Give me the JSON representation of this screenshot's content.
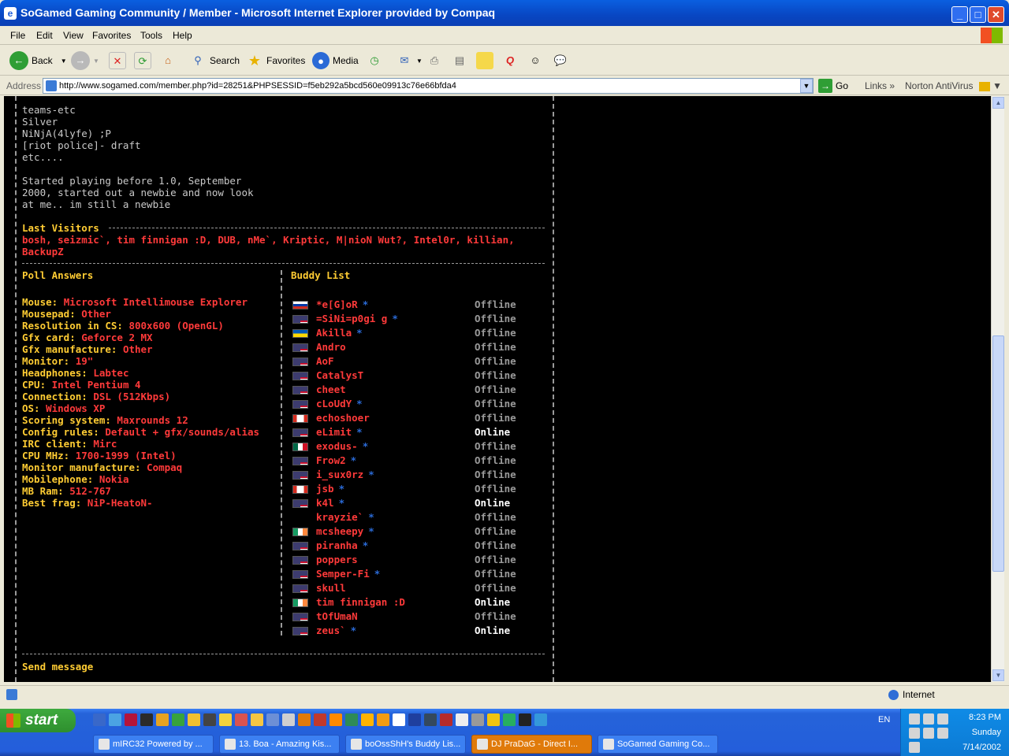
{
  "window": {
    "title": "SoGamed Gaming Community / Member - Microsoft Internet Explorer provided by Compaq"
  },
  "menu": [
    "File",
    "Edit",
    "View",
    "Favorites",
    "Tools",
    "Help"
  ],
  "toolbar": {
    "back": "Back",
    "search": "Search",
    "favorites": "Favorites",
    "media": "Media"
  },
  "address": {
    "label": "Address",
    "url": "http://www.sogamed.com/member.php?id=28251&PHPSESSID=f5eb292a5bcd560e09913c76e66bfda4",
    "go": "Go",
    "links": "Links",
    "norton": "Norton AntiVirus"
  },
  "profile": {
    "about_lines": [
      "teams-etc",
      "Silver",
      "NiNjA(4lyfe) ;P",
      "[riot police]- draft",
      "etc....",
      "",
      "Started playing before 1.0, September",
      "2000, started out a newbie and now look",
      "at me.. im still a newbie"
    ],
    "last_visitors_title": "Last Visitors",
    "last_visitors": "bosh, seizmic`, tim finnigan :D, DUB, nMe`, Kriptic, M|nioN Wut?, Intel0r, killian, BackupZ",
    "poll_title": "Poll Answers",
    "poll": [
      {
        "label": "Mouse:",
        "value": "Microsoft Intellimouse Explorer"
      },
      {
        "label": "Mousepad:",
        "value": "Other"
      },
      {
        "label": "Resolution in CS:",
        "value": "800x600 (OpenGL)"
      },
      {
        "label": "Gfx card:",
        "value": "Geforce 2 MX"
      },
      {
        "label": "Gfx manufacture:",
        "value": "Other"
      },
      {
        "label": "Monitor:",
        "value": "19\""
      },
      {
        "label": "Headphones:",
        "value": "Labtec"
      },
      {
        "label": "CPU:",
        "value": "Intel Pentium 4"
      },
      {
        "label": "Connection:",
        "value": "DSL (512Kbps)"
      },
      {
        "label": "OS:",
        "value": "Windows XP"
      },
      {
        "label": "Scoring system:",
        "value": "Maxrounds 12"
      },
      {
        "label": "Config rules:",
        "value": "Default + gfx/sounds/alias"
      },
      {
        "label": "IRC client:",
        "value": "Mirc"
      },
      {
        "label": "CPU MHz:",
        "value": "1700-1999 (Intel)"
      },
      {
        "label": "Monitor manufacture:",
        "value": "Compaq"
      },
      {
        "label": "Mobilephone:",
        "value": "Nokia"
      },
      {
        "label": "MB Ram:",
        "value": "512-767"
      },
      {
        "label": "Best frag:",
        "value": "NiP-HeatoN-"
      }
    ],
    "buddy_title": "Buddy List",
    "buddies": [
      {
        "name": "*e[G]oR",
        "star": "*",
        "status": "Offline",
        "flag": "ru"
      },
      {
        "name": "=SiNi=p0gi g",
        "star": "*",
        "status": "Offline",
        "flag": "us"
      },
      {
        "name": "Akilla",
        "star": "*",
        "status": "Offline",
        "flag": "ua"
      },
      {
        "name": "Andro",
        "star": "",
        "status": "Offline",
        "flag": "us"
      },
      {
        "name": "AoF",
        "star": "",
        "status": "Offline",
        "flag": "us"
      },
      {
        "name": "CatalysT",
        "star": "",
        "status": "Offline",
        "flag": "us"
      },
      {
        "name": "cheet",
        "star": "",
        "status": "Offline",
        "flag": "us"
      },
      {
        "name": "cLoUdY",
        "star": "*",
        "status": "Offline",
        "flag": "us"
      },
      {
        "name": "echoshoer",
        "star": "",
        "status": "Offline",
        "flag": "ca"
      },
      {
        "name": "eLimit",
        "star": "*",
        "status": "Online",
        "flag": "us"
      },
      {
        "name": "exodus-",
        "star": "*",
        "status": "Offline",
        "flag": "mx"
      },
      {
        "name": "Frow2",
        "star": "*",
        "status": "Offline",
        "flag": "us"
      },
      {
        "name": "i_sux0rz",
        "star": "*",
        "status": "Offline",
        "flag": "us"
      },
      {
        "name": "jsb",
        "star": "*",
        "status": "Offline",
        "flag": "ca"
      },
      {
        "name": "k4l",
        "star": "*",
        "status": "Online",
        "flag": "us"
      },
      {
        "name": "krayzie`",
        "star": "*",
        "status": "Offline",
        "flag": "none"
      },
      {
        "name": "mcsheepy",
        "star": "*",
        "status": "Offline",
        "flag": "ie"
      },
      {
        "name": "piranha",
        "star": "*",
        "status": "Offline",
        "flag": "us"
      },
      {
        "name": "poppers",
        "star": "",
        "status": "Offline",
        "flag": "us"
      },
      {
        "name": "Semper-Fi",
        "star": "*",
        "status": "Offline",
        "flag": "us"
      },
      {
        "name": "skull",
        "star": "",
        "status": "Offline",
        "flag": "us"
      },
      {
        "name": "tim finnigan :D",
        "star": "",
        "status": "Online",
        "flag": "ie"
      },
      {
        "name": "tOfUmaN",
        "star": "",
        "status": "Offline",
        "flag": "us"
      },
      {
        "name": "zeus`",
        "star": "*",
        "status": "Online",
        "flag": "us"
      }
    ],
    "send_message": "Send message"
  },
  "status_bar": {
    "zone": "Internet"
  },
  "taskbar": {
    "start": "start",
    "lang": "EN",
    "tasks": [
      {
        "label": "mIRC32 Powered by ...",
        "active": false
      },
      {
        "label": "13. Boa - Amazing Kis...",
        "active": false
      },
      {
        "label": "boOssShH's Buddy Lis...",
        "active": false
      },
      {
        "label": "DJ PraDaG - Direct I...",
        "active": true
      },
      {
        "label": "SoGamed Gaming Co...",
        "active": false
      }
    ],
    "clock": {
      "time": "8:23 PM",
      "day": "Sunday",
      "date": "7/14/2002"
    }
  },
  "colors": {
    "accent_red": "#ff3a3a",
    "heading_yellow": "#ffcc33",
    "online": "#ffffff",
    "offline": "#9a9a9a",
    "star_blue": "#2a6ad6"
  }
}
